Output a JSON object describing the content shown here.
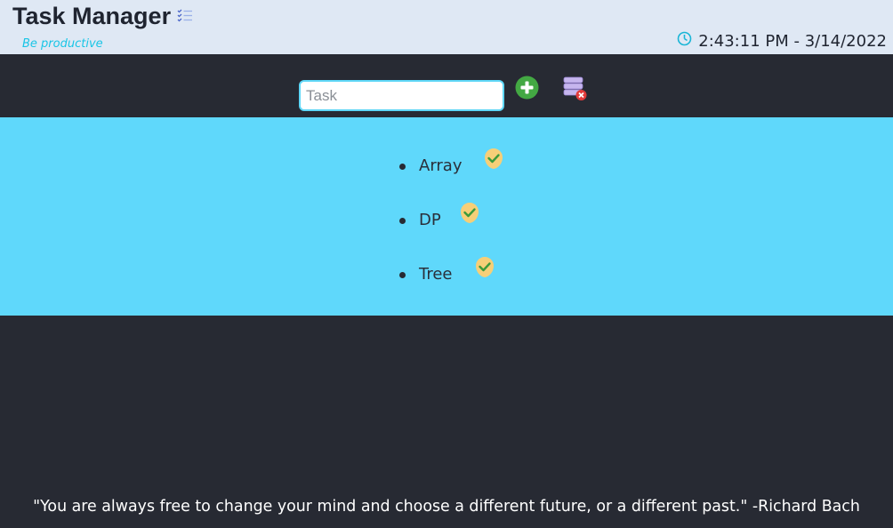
{
  "header": {
    "title": "Task Manager",
    "title_icon": "checklist-icon",
    "tagline": "Be productive",
    "clock_icon": "clock-icon",
    "datetime": "2:43:11 PM - 3/14/2022"
  },
  "toolbar": {
    "task_input": {
      "placeholder": "Task",
      "value": ""
    },
    "add_button_icon": "plus-circle-icon",
    "clear_button_icon": "database-delete-icon"
  },
  "tasks": [
    {
      "label": "Array",
      "done_icon": "check-badge-icon"
    },
    {
      "label": "DP",
      "done_icon": "check-badge-icon"
    },
    {
      "label": "Tree",
      "done_icon": "check-badge-icon"
    }
  ],
  "quote": "\"You are always free to change your mind and choose a different future, or a different past.\" -Richard Bach",
  "colors": {
    "header_bg": "#dfe8f4",
    "page_bg": "#272a33",
    "list_bg": "#5fd8fb",
    "accent_cyan": "#19c5e6",
    "add_green": "#43a843",
    "check_yellow": "#f6cf78",
    "check_green": "#3b9a3b",
    "delete_red": "#e23b3b",
    "db_purple": "#b9a7e4"
  }
}
